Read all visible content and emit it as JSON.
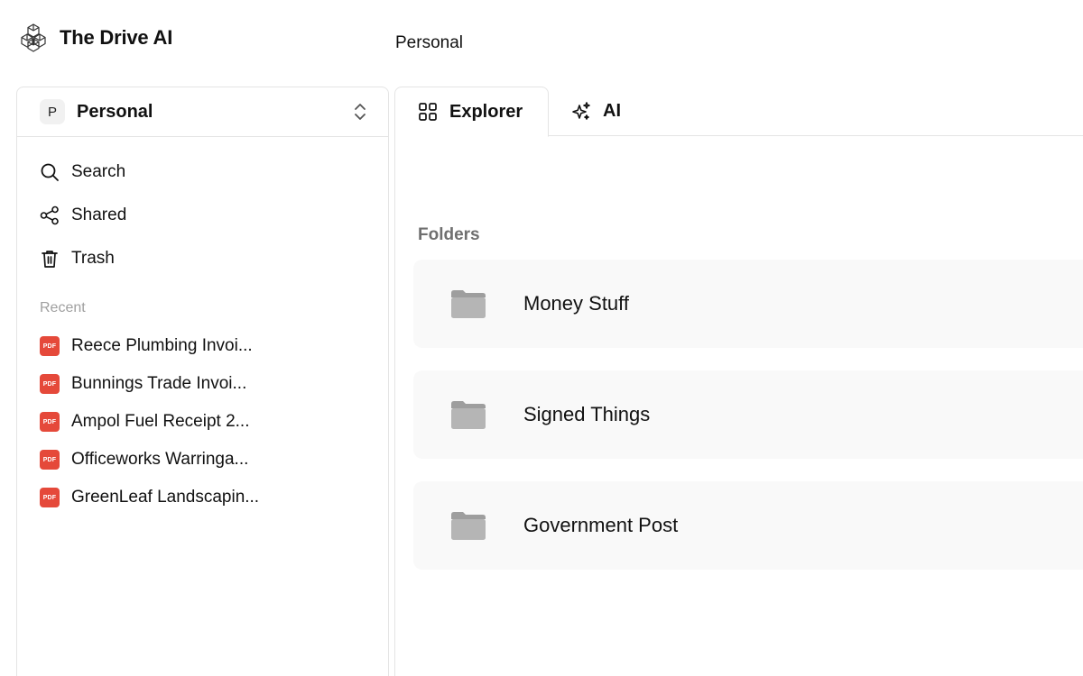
{
  "app": {
    "name": "The Drive AI",
    "logo_icon": "drive-ai-logo-icon"
  },
  "header": {
    "breadcrumb": "Personal"
  },
  "sidebar": {
    "workspace": {
      "avatar_letter": "P",
      "name": "Personal",
      "chevron_icon": "chevron-up-down-icon"
    },
    "nav": [
      {
        "label": "Search",
        "icon": "search-icon"
      },
      {
        "label": "Shared",
        "icon": "share-icon"
      },
      {
        "label": "Trash",
        "icon": "trash-icon"
      }
    ],
    "recent_title": "Recent",
    "recent": [
      {
        "label": "Reece Plumbing Invoi...",
        "badge": "PDF"
      },
      {
        "label": "Bunnings Trade Invoi...",
        "badge": "PDF"
      },
      {
        "label": "Ampol Fuel Receipt 2...",
        "badge": "PDF"
      },
      {
        "label": "Officeworks Warringa...",
        "badge": "PDF"
      },
      {
        "label": "GreenLeaf Landscapin...",
        "badge": "PDF"
      }
    ]
  },
  "tabs": [
    {
      "label": "Explorer",
      "icon": "grid-icon",
      "active": true
    },
    {
      "label": "AI",
      "icon": "sparkles-icon",
      "active": false
    }
  ],
  "main": {
    "folders_title": "Folders",
    "folders": [
      {
        "label": "Money Stuff",
        "icon": "folder-icon"
      },
      {
        "label": "Signed Things",
        "icon": "folder-icon"
      },
      {
        "label": "Government Post",
        "icon": "folder-icon"
      }
    ]
  },
  "colors": {
    "pdf_badge": "#e5493a",
    "folder": "#a6a6a6",
    "card_bg": "#f9f9f9",
    "border": "#e4e4e4"
  }
}
